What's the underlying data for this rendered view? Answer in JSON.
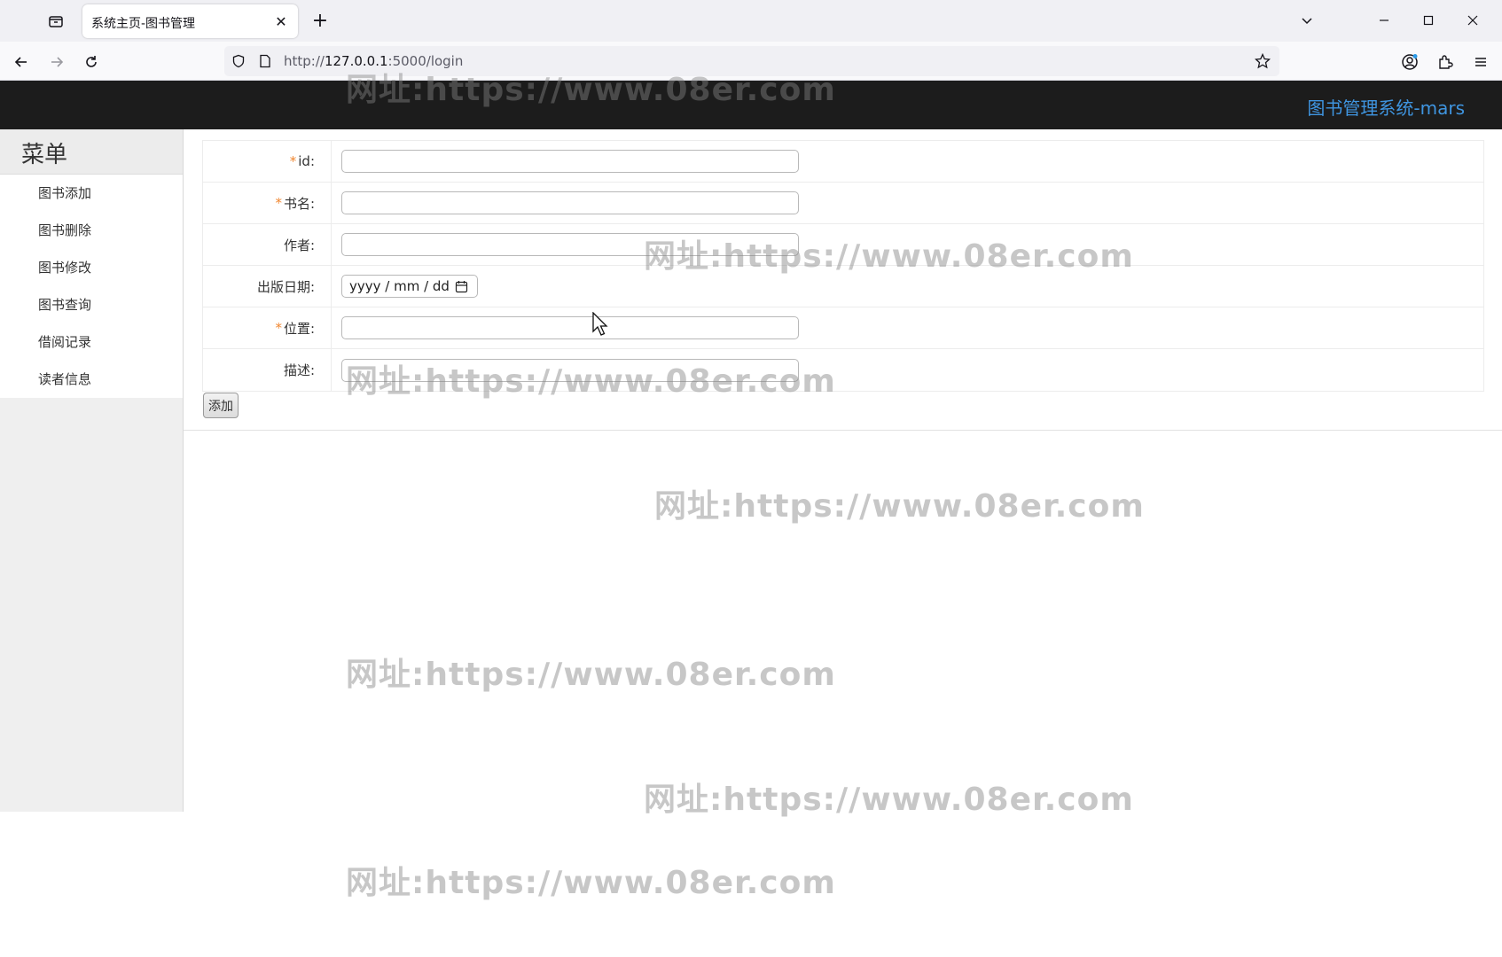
{
  "browser": {
    "tab_title": "系统主页-图书管理",
    "url_prefix": "http://",
    "url_host": "127.0.0.1",
    "url_rest": ":5000/login"
  },
  "app": {
    "brand": "图书管理系统-mars"
  },
  "sidebar": {
    "title": "菜单",
    "items": [
      {
        "label": "图书添加"
      },
      {
        "label": "图书删除"
      },
      {
        "label": "图书修改"
      },
      {
        "label": "图书查询"
      },
      {
        "label": "借阅记录"
      },
      {
        "label": "读者信息"
      }
    ]
  },
  "form": {
    "fields": [
      {
        "label": "id:",
        "required": true
      },
      {
        "label": "书名:",
        "required": true
      },
      {
        "label": "作者:",
        "required": false
      },
      {
        "label": "出版日期:",
        "required": false
      },
      {
        "label": "位置:",
        "required": true
      },
      {
        "label": "描述:",
        "required": false
      }
    ],
    "required_mark": "*",
    "date_placeholder": "yyyy / mm / dd",
    "submit_label": "添加"
  },
  "watermark": {
    "text": "网址:https://www.08er.com"
  },
  "colors": {
    "header_bg": "#1c1c1c",
    "brand": "#3f95e0",
    "required_mark": "#f0862f",
    "sidebar_bg": "#efefef"
  }
}
